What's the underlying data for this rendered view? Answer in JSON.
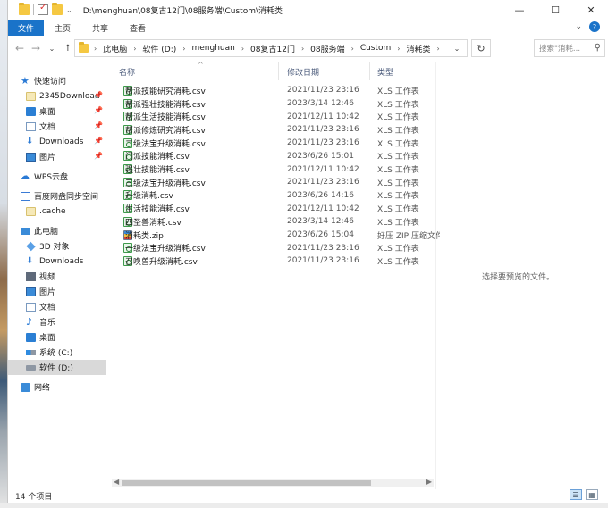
{
  "window": {
    "title": "D:\\menghuan\\08复古12门\\08服务端\\Custom\\消耗类",
    "minimize": "—",
    "maximize": "☐",
    "close": "✕"
  },
  "ribbon": {
    "tabs": [
      "文件",
      "主页",
      "共享",
      "查看"
    ],
    "expand": "⌄",
    "help": "?"
  },
  "address": {
    "crumbs": [
      "此电脑",
      "软件 (D:)",
      "menghuan",
      "08复古12门",
      "08服务端",
      "Custom",
      "消耗类"
    ],
    "search_placeholder": "搜索\"消耗...",
    "back": "←",
    "forward": "→",
    "recent": "⌄",
    "up": "↑",
    "refresh": "↻",
    "dropdown": "⌄",
    "crumb_chevron": "›"
  },
  "nav": {
    "quick_access": "快速访问",
    "quick_items": [
      "2345Download",
      "桌面",
      "文档",
      "Downloads",
      "图片"
    ],
    "wps": "WPS云盘",
    "baidu": "百度网盘同步空间",
    "cache": ".cache",
    "this_pc": "此电脑",
    "pc_items": [
      "3D 对象",
      "Downloads",
      "视频",
      "图片",
      "文档",
      "音乐",
      "桌面",
      "系统 (C:)",
      "软件 (D:)"
    ],
    "network": "网络",
    "pin": "📌"
  },
  "columns": {
    "name": "名称",
    "date": "修改日期",
    "type": "类型",
    "sort_indicator": "^"
  },
  "files": [
    {
      "name": "帮派技能研究消耗.csv",
      "date": "2021/11/23 23:16",
      "type": "XLS 工作表"
    },
    {
      "name": "帮派强壮技能消耗.csv",
      "date": "2023/3/14 12:46",
      "type": "XLS 工作表"
    },
    {
      "name": "帮派生活技能消耗.csv",
      "date": "2021/12/11 10:42",
      "type": "XLS 工作表"
    },
    {
      "name": "帮派修炼研究消耗.csv",
      "date": "2021/11/23 23:16",
      "type": "XLS 工作表"
    },
    {
      "name": "二级法宝升级消耗.csv",
      "date": "2021/11/23 23:16",
      "type": "XLS 工作表"
    },
    {
      "name": "门派技能消耗.csv",
      "date": "2023/6/26 15:01",
      "type": "XLS 工作表"
    },
    {
      "name": "强壮技能消耗.csv",
      "date": "2021/12/11 10:42",
      "type": "XLS 工作表"
    },
    {
      "name": "三级法宝升级消耗.csv",
      "date": "2021/11/23 23:16",
      "type": "XLS 工作表"
    },
    {
      "name": "升级消耗.csv",
      "date": "2023/6/26 14:16",
      "type": "XLS 工作表"
    },
    {
      "name": "生活技能消耗.csv",
      "date": "2021/12/11 10:42",
      "type": "XLS 工作表"
    },
    {
      "name": "四圣兽消耗.csv",
      "date": "2023/3/14 12:46",
      "type": "XLS 工作表"
    },
    {
      "name": "消耗类.zip",
      "date": "2023/6/26 15:04",
      "type": "好压 ZIP 压缩文件"
    },
    {
      "name": "一级法宝升级消耗.csv",
      "date": "2021/11/23 23:16",
      "type": "XLS 工作表"
    },
    {
      "name": "召唤兽升级消耗.csv",
      "date": "2021/11/23 23:16",
      "type": "XLS 工作表"
    }
  ],
  "preview": "选择要预览的文件。",
  "status": {
    "count": "14 个项目"
  },
  "scroll": {
    "left": "◀",
    "right": "▶"
  },
  "views": {
    "details": "☰",
    "tiles": "▦"
  }
}
